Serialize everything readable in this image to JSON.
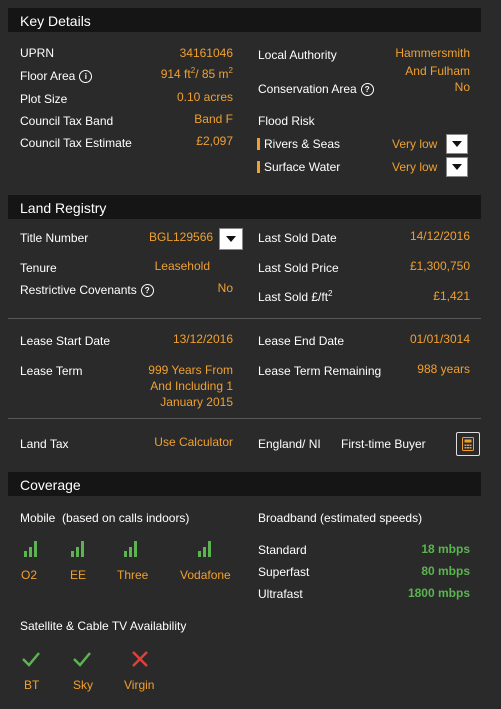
{
  "key_details": {
    "header": "Key Details",
    "uprn_label": "UPRN",
    "uprn_value": "34161046",
    "floor_area_label": "Floor Area",
    "floor_area_ft_num": "914 ft",
    "floor_area_ft_exp": "2",
    "floor_area_sep": "/ 85 m",
    "floor_area_m_exp": "2",
    "plot_size_label": "Plot Size",
    "plot_size_value": "0.10 acres",
    "council_tax_band_label": "Council Tax Band",
    "council_tax_band_value": "Band F",
    "council_tax_est_label": "Council Tax Estimate",
    "council_tax_est_value": "£2,097",
    "local_authority_label": "Local Authority",
    "local_authority_line1": "Hammersmith",
    "local_authority_line2": "And Fulham",
    "conservation_label": "Conservation Area",
    "conservation_value": "No",
    "flood_risk_label": "Flood Risk",
    "rivers_label": "Rivers & Seas",
    "rivers_value": "Very low",
    "surface_label": "Surface Water",
    "surface_value": "Very low"
  },
  "land_registry": {
    "header": "Land Registry",
    "title_number_label": "Title Number",
    "title_number_value": "BGL129566",
    "tenure_label": "Tenure",
    "tenure_value": "Leasehold",
    "restrictive_label": "Restrictive Covenants",
    "restrictive_value": "No",
    "last_sold_date_label": "Last Sold Date",
    "last_sold_date_value": "14/12/2016",
    "last_sold_price_label": "Last Sold Price",
    "last_sold_price_value": "£1,300,750",
    "last_sold_ft_label_base": "Last Sold £/ft",
    "last_sold_ft_label_exp": "2",
    "last_sold_ft_value": "£1,421",
    "lease_start_label": "Lease Start Date",
    "lease_start_value": "13/12/2016",
    "lease_end_label": "Lease End Date",
    "lease_end_value": "01/01/3014",
    "lease_term_label": "Lease Term",
    "lease_term_line1": "999 Years From",
    "lease_term_line2": "And Including 1",
    "lease_term_line3": "January 2015",
    "lease_remaining_label": "Lease Term Remaining",
    "lease_remaining_value": "988 years",
    "land_tax_label": "Land Tax",
    "land_tax_link": "Use Calculator",
    "england_ni_label": "England/ NI",
    "first_time_label": "First-time Buyer"
  },
  "coverage": {
    "header": "Coverage",
    "mobile_label": "Mobile",
    "mobile_note": "(based on calls indoors)",
    "carriers": [
      "O2",
      "EE",
      "Three",
      "Vodafone"
    ],
    "broadband_label": "Broadband (estimated speeds)",
    "broadband": [
      {
        "name": "Standard",
        "speed": "18 mbps"
      },
      {
        "name": "Superfast",
        "speed": "80 mbps"
      },
      {
        "name": "Ultrafast",
        "speed": "1800 mbps"
      }
    ],
    "tv_label": "Satellite & Cable TV Availability",
    "tv": [
      {
        "name": "BT",
        "available": true
      },
      {
        "name": "Sky",
        "available": true
      },
      {
        "name": "Virgin",
        "available": false
      }
    ]
  },
  "colors": {
    "accent": "#f0a030",
    "good": "#5bb450",
    "bad": "#e0403a",
    "header_bg": "#151515",
    "panel_bg": "#2a2a2a"
  }
}
